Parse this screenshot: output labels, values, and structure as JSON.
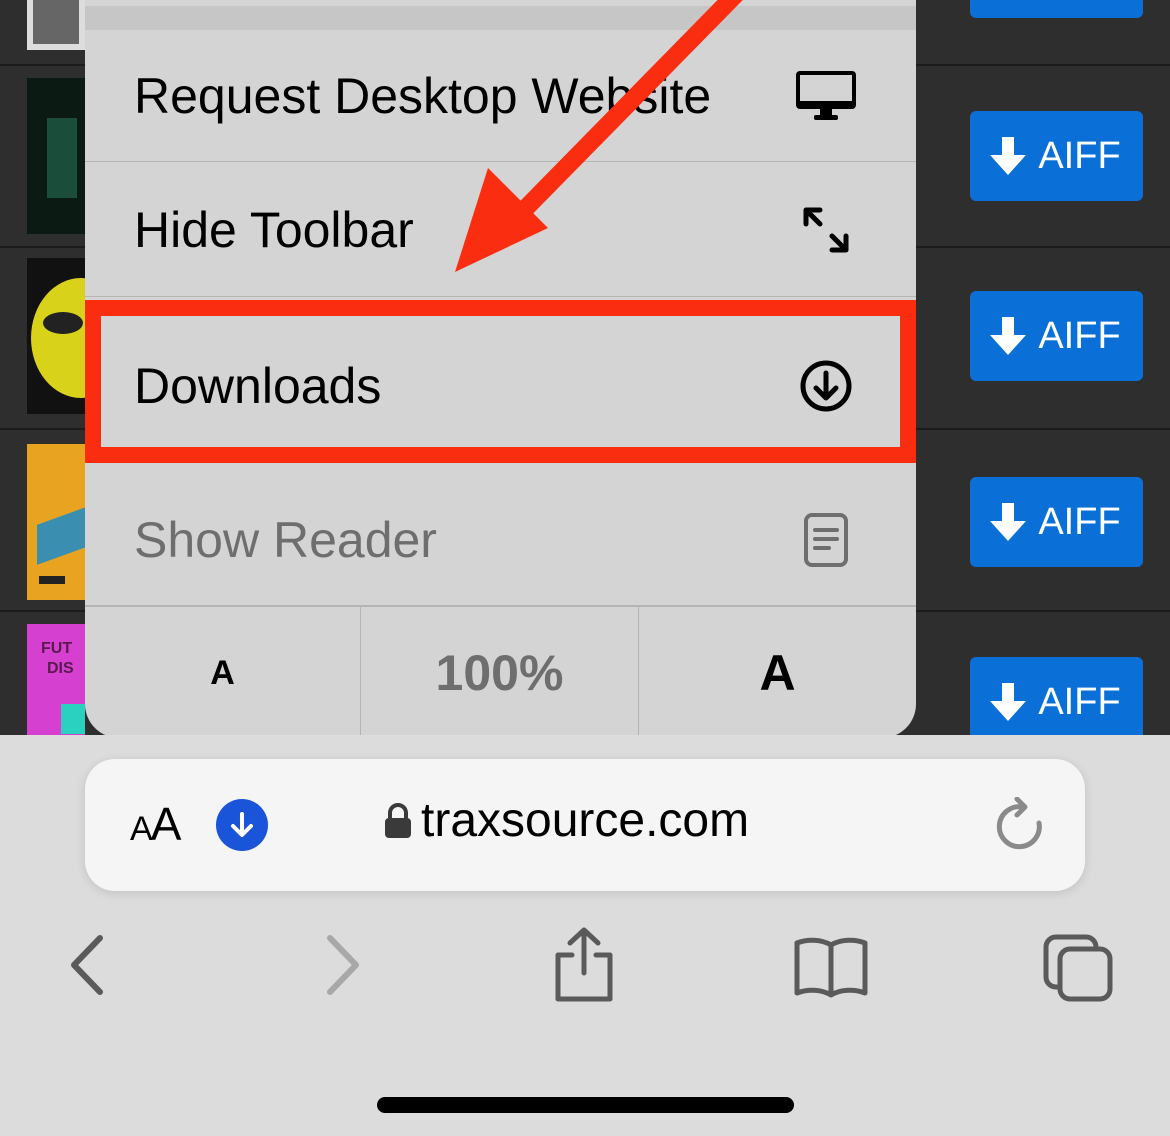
{
  "background_page": {
    "download_buttons": [
      {
        "label": "AIFF"
      },
      {
        "label": "AIFF"
      },
      {
        "label": "AIFF"
      },
      {
        "label": "AIFF"
      }
    ]
  },
  "menu": {
    "items": [
      {
        "label": "Request Desktop Website",
        "icon": "desktop-icon"
      },
      {
        "label": "Hide Toolbar",
        "icon": "expand-arrows-icon"
      },
      {
        "label": "Downloads",
        "icon": "download-circle-icon"
      },
      {
        "label": "Show Reader",
        "icon": "reader-icon",
        "disabled": true
      }
    ],
    "font_controls": {
      "smaller": "A",
      "zoom": "100%",
      "larger": "A"
    }
  },
  "annotation": {
    "highlight_color": "#fa2d10"
  },
  "address_bar": {
    "aa_small": "A",
    "aa_large": "A",
    "url": "traxsource.com"
  },
  "toolbar": {
    "buttons": [
      "back-icon",
      "forward-icon",
      "share-icon",
      "bookmarks-icon",
      "tabs-icon"
    ]
  },
  "colors": {
    "aiff_button": "#0a6fd6",
    "download_indicator": "#1a54d8"
  }
}
